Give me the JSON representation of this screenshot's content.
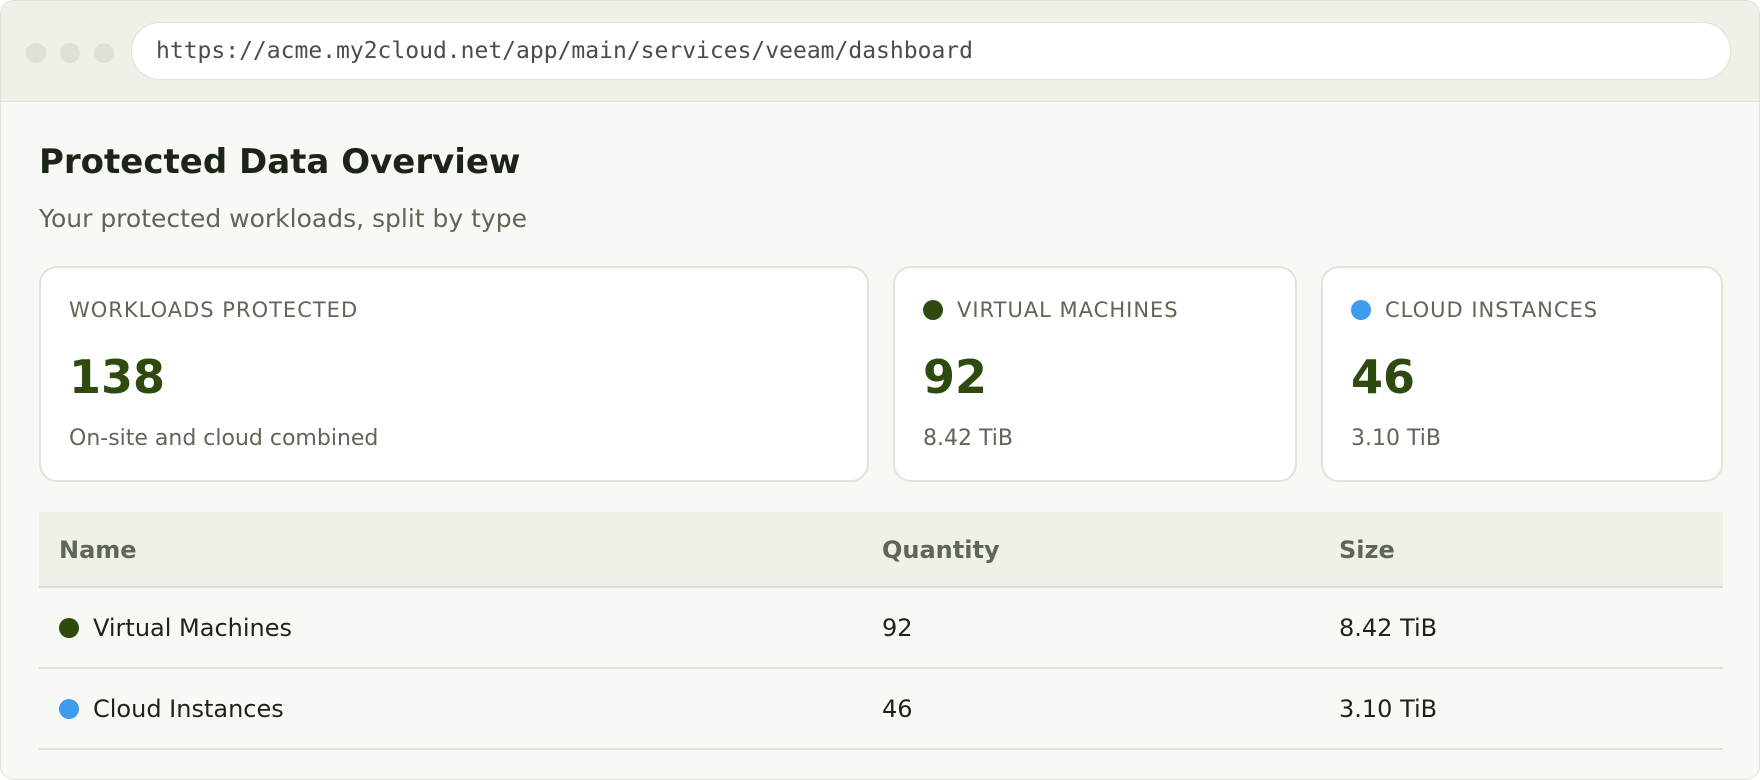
{
  "browser": {
    "url": "https://acme.my2cloud.net/app/main/services/veeam/dashboard"
  },
  "page": {
    "title": "Protected Data Overview",
    "subtitle": "Your protected workloads, split by type"
  },
  "cards": {
    "total": {
      "label": "WORKLOADS PROTECTED",
      "value": "138",
      "sub": "On-site and cloud combined"
    },
    "vms": {
      "label": "VIRTUAL MACHINES",
      "value": "92",
      "sub": "8.42 TiB",
      "color": "#2e4a0e"
    },
    "cloud": {
      "label": "CLOUD INSTANCES",
      "value": "46",
      "sub": "3.10 TiB",
      "color": "#3d9bf0"
    }
  },
  "table": {
    "headers": [
      "Name",
      "Quantity",
      "Size"
    ],
    "rows": [
      {
        "name": "Virtual Machines",
        "quantity": "92",
        "size": "8.42 TiB",
        "color": "#2e4a0e"
      },
      {
        "name": "Cloud Instances",
        "quantity": "46",
        "size": "3.10 TiB",
        "color": "#3d9bf0"
      }
    ]
  }
}
